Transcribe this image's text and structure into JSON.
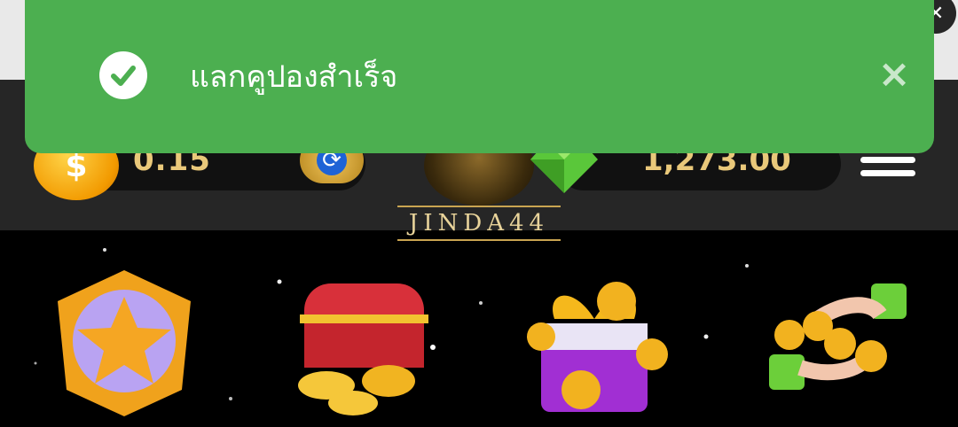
{
  "toast": {
    "message": "แลกคูปองสำเร็จ",
    "close_glyph": "×",
    "icon": "check-circle-icon",
    "color": "#4caf50"
  },
  "header": {
    "credit_balance": "0.15",
    "diamond_balance": "1,273.00",
    "logo_text": "JINDA44",
    "coin_symbol": "$",
    "refresh_glyph": "⟳",
    "icons": [
      "coin-icon",
      "refresh-icon",
      "gem-icon",
      "menu-icon"
    ]
  },
  "promotions": {
    "icons": [
      "star-badge-icon",
      "treasure-chest-icon",
      "gift-box-icon",
      "coin-exchange-icon"
    ]
  },
  "colors": {
    "header_bg": "#262626",
    "gold_text": "#e9c87a",
    "page_bg": "#000000"
  }
}
